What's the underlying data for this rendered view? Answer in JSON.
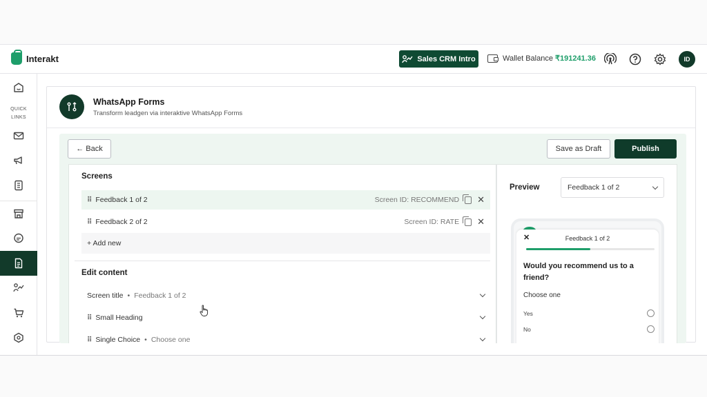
{
  "app": {
    "name": "Interakt"
  },
  "topbar": {
    "crm_button": "Sales CRM Intro",
    "wallet_label": "Wallet Balance",
    "wallet_amount": "₹191241.36",
    "avatar_initials": "ID"
  },
  "sidebar": {
    "quick_links_line1": "QUICK",
    "quick_links_line2": "LINKS"
  },
  "page": {
    "title": "WhatsApp Forms",
    "subtitle": "Transform leadgen via interaktive WhatsApp Forms"
  },
  "toolbar": {
    "back": "← Back",
    "save_draft": "Save as Draft",
    "publish": "Publish"
  },
  "screens": {
    "title": "Screens",
    "items": [
      {
        "label": "Feedback 1 of 2",
        "screen_id": "Screen ID: RECOMMEND"
      },
      {
        "label": "Feedback 2 of 2",
        "screen_id": "Screen ID: RATE"
      }
    ],
    "add_new": "+ Add new"
  },
  "edit_content": {
    "title": "Edit content",
    "rows": [
      {
        "label": "Screen title",
        "value": "Feedback 1 of 2"
      },
      {
        "label": "Small Heading",
        "value": ""
      },
      {
        "label": "Single Choice",
        "value": "Choose one"
      }
    ]
  },
  "preview": {
    "label": "Preview",
    "selected_screen": "Feedback 1 of 2",
    "sheet_title": "Feedback 1 of 2",
    "progress_fraction": 0.5,
    "question": "Would you recommend us to a friend?",
    "choose_label": "Choose one",
    "options": [
      "Yes",
      "No"
    ]
  },
  "colors": {
    "brand_green": "#1e9e6a",
    "dark_green": "#0f3b2a"
  }
}
